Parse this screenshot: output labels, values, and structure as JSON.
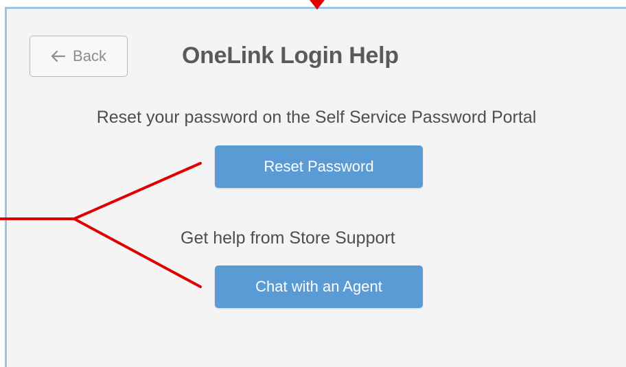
{
  "header": {
    "back_label": "Back",
    "title": "OneLink Login Help"
  },
  "reset_section": {
    "description": "Reset your password on the Self Service Password Portal",
    "button_label": "Reset Password"
  },
  "support_section": {
    "description": "Get help from Store Support",
    "button_label": "Chat with an Agent"
  },
  "icons": {
    "back": "arrow-left-icon"
  },
  "colors": {
    "button": "#5a9bd6",
    "panel_background": "#f4f4f4",
    "panel_border": "#9cc4e6",
    "title_text": "#5a5a5a",
    "annotation": "#e00000"
  }
}
